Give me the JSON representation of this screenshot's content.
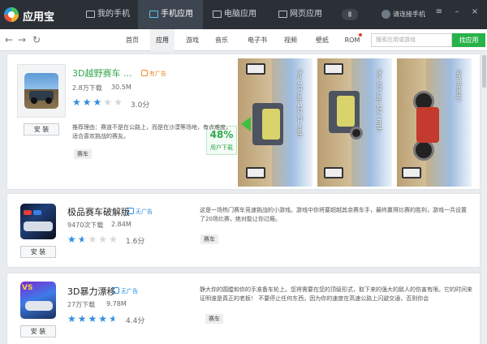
{
  "app": {
    "name": "应用宝"
  },
  "topbar": {
    "tabs": [
      {
        "label": "我的手机",
        "icon": "phone-icon"
      },
      {
        "label": "手机应用",
        "icon": "apps-icon"
      },
      {
        "label": "电脑应用",
        "icon": "monitor-icon"
      },
      {
        "label": "网页应用",
        "icon": "window-icon"
      }
    ],
    "active_tab": "手机应用",
    "login_text": "请连接手机",
    "window_controls": [
      "≡",
      "–",
      "×"
    ]
  },
  "navbar": {
    "back": "←",
    "forward": "→",
    "refresh": "↻",
    "categories": [
      "首页",
      "应用",
      "游戏",
      "音乐",
      "电子书",
      "视频",
      "壁纸",
      "ROM"
    ],
    "active_category": "应用",
    "search_placeholder": "搜索应用或游戏",
    "search_button": "找应用"
  },
  "apps": [
    {
      "title": "3D越野赛车 ...",
      "ad_badge": "有广告",
      "downloads": "2.8万下载",
      "size": "30.5M",
      "rating": 3.0,
      "rating_text": "3.0分",
      "description": "推荐理由：赛道不是在公路上，而是在沙漠等场地，有点难度，适合喜欢挑战的赛友。",
      "tag": "赛车",
      "install": "安 装",
      "good_rate": "48%",
      "good_rate_label": "用户下载",
      "screenshot_hud": [
        "Pos 1/3 Lap 1/2 Z1 mph",
        "Pos 3/3 Lap 1/2 / mph",
        "Get Ready!"
      ]
    },
    {
      "title": "极品赛车破解版",
      "ad_badge": "无广告",
      "downloads": "9470次下载",
      "size": "2.84M",
      "rating": 1.6,
      "rating_text": "1.6分",
      "description": "这是一场热门赛车竞速挑战的小游戏。游戏中你将要超越其余赛车手，最终赢得比赛的胜利，游戏一共设置了20场比赛，绝对能让你过瘾。",
      "tag": "赛车",
      "install": "安 装"
    },
    {
      "title": "3D暴力漂移",
      "ad_badge": "无广告",
      "downloads": "27万下载",
      "size": "9.78M",
      "rating": 4.4,
      "rating_text": "4.4分",
      "description": "静大你的圆膛和你的手准备车轮上。您将需要在您的顶级形式，取下来的强大的敌人的伤害有限。它的时间来证明谁是真正的老板！ 不要停止任何东西，因为你的速度在高速公路上闪避交通，否则你会",
      "tag": "赛车",
      "install": "安 装"
    }
  ],
  "colors": {
    "topbar_bg": "#2b3036",
    "accent_green": "#27b24a",
    "star_blue": "#2f8ee0",
    "ad_orange": "#f08a27"
  }
}
